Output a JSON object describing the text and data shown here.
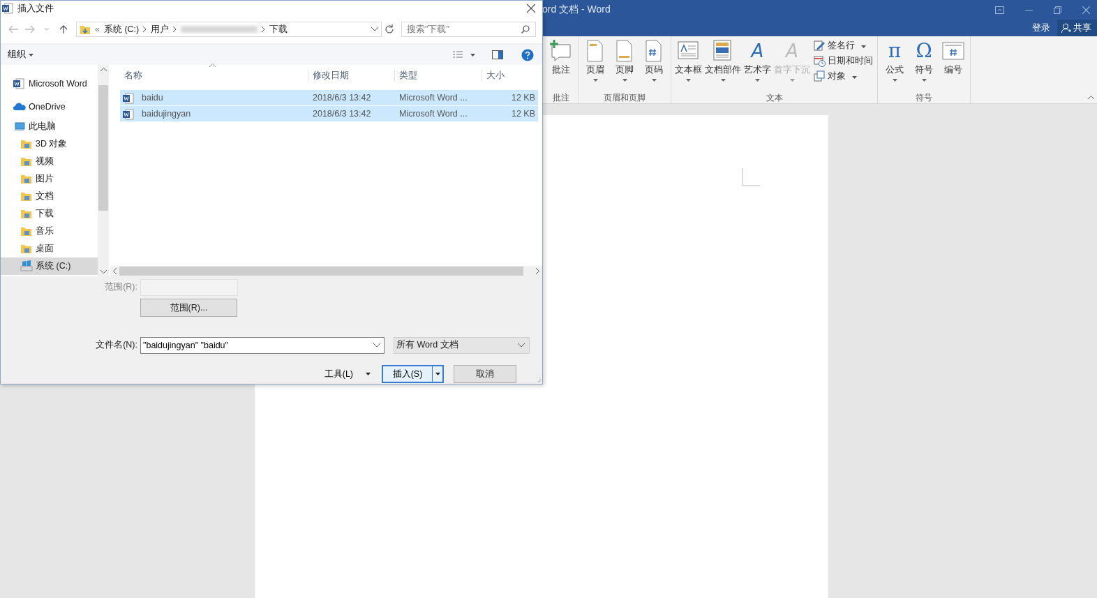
{
  "word": {
    "title": "ord 文档 - Word",
    "login": "登录",
    "share": "共享",
    "ribbon": [
      {
        "label": "批注",
        "buttons": [
          {
            "kind": "comment",
            "label": "批注",
            "dropdown": false,
            "disabled": false
          }
        ]
      },
      {
        "label": "页眉和页脚",
        "buttons": [
          {
            "kind": "header",
            "label": "页眉",
            "dropdown": true,
            "disabled": false
          },
          {
            "kind": "footer",
            "label": "页脚",
            "dropdown": true,
            "disabled": false
          },
          {
            "kind": "pagenum",
            "label": "页码",
            "dropdown": true,
            "disabled": false
          }
        ]
      },
      {
        "label": "文本",
        "buttons": [
          {
            "kind": "textbox",
            "label": "文本框",
            "dropdown": true,
            "disabled": false
          },
          {
            "kind": "parts",
            "label": "文档部件",
            "dropdown": true,
            "disabled": false
          },
          {
            "kind": "glyph",
            "glyph": "A",
            "label": "艺术字",
            "dropdown": true,
            "disabled": false
          },
          {
            "kind": "glyph",
            "glyph": "A",
            "label": "首字下沉",
            "dropdown": true,
            "disabled": true
          }
        ],
        "small": [
          {
            "kind": "signature",
            "label": "签名行",
            "dropdown": true
          },
          {
            "kind": "datetime",
            "label": "日期和时间",
            "dropdown": false
          },
          {
            "kind": "object",
            "label": "对象",
            "dropdown": true
          }
        ]
      },
      {
        "label": "符号",
        "buttons": [
          {
            "kind": "glyph",
            "glyph": "π",
            "label": "公式",
            "dropdown": true,
            "disabled": false
          },
          {
            "kind": "glyph",
            "glyph": "Ω",
            "label": "符号",
            "dropdown": true,
            "disabled": false
          },
          {
            "kind": "number",
            "label": "编号",
            "dropdown": false,
            "disabled": false
          }
        ]
      }
    ]
  },
  "dialog": {
    "title": "插入文件",
    "path_overflow": "«",
    "path": [
      {
        "kind": "text",
        "text": "系统 (C:)"
      },
      {
        "kind": "text",
        "text": "用户"
      },
      {
        "kind": "blurred"
      },
      {
        "kind": "text",
        "text": "下载"
      }
    ],
    "search": {
      "placeholder": "搜索\"下载\""
    },
    "organize": "组织",
    "sidebar": [
      {
        "kind": "word",
        "label": "Microsoft Word",
        "selected": false
      },
      {
        "kind": "cloud",
        "label": "OneDrive",
        "selected": false
      },
      {
        "kind": "pc",
        "label": "此电脑",
        "selected": false,
        "children": [
          {
            "kind": "folder",
            "label": "3D 对象",
            "selected": false
          },
          {
            "kind": "folder",
            "label": "视频",
            "selected": false
          },
          {
            "kind": "folder",
            "label": "图片",
            "selected": false
          },
          {
            "kind": "folder",
            "label": "文档",
            "selected": false
          },
          {
            "kind": "folder",
            "label": "下载",
            "selected": false
          },
          {
            "kind": "folder",
            "label": "音乐",
            "selected": false
          },
          {
            "kind": "folder",
            "label": "桌面",
            "selected": false
          },
          {
            "kind": "drive",
            "label": "系统 (C:)",
            "selected": true
          }
        ]
      }
    ],
    "columns": [
      "名称",
      "修改日期",
      "类型",
      "大小"
    ],
    "files": [
      {
        "name": "baidu",
        "modified": "2018/6/3 13:42",
        "type": "Microsoft Word ...",
        "size": "12 KB",
        "selected": true
      },
      {
        "name": "baidujingyan",
        "modified": "2018/6/3 13:42",
        "type": "Microsoft Word ...",
        "size": "12 KB",
        "selected": true
      }
    ],
    "range_label": "范围(R):",
    "range_button": "范围(R)...",
    "filename_label": "文件名(N):",
    "filename": "\"baidujingyan\" \"baidu\"",
    "filter": "所有 Word 文档",
    "tools": "工具(L)",
    "insert": "插入(S)",
    "cancel": "取消"
  }
}
